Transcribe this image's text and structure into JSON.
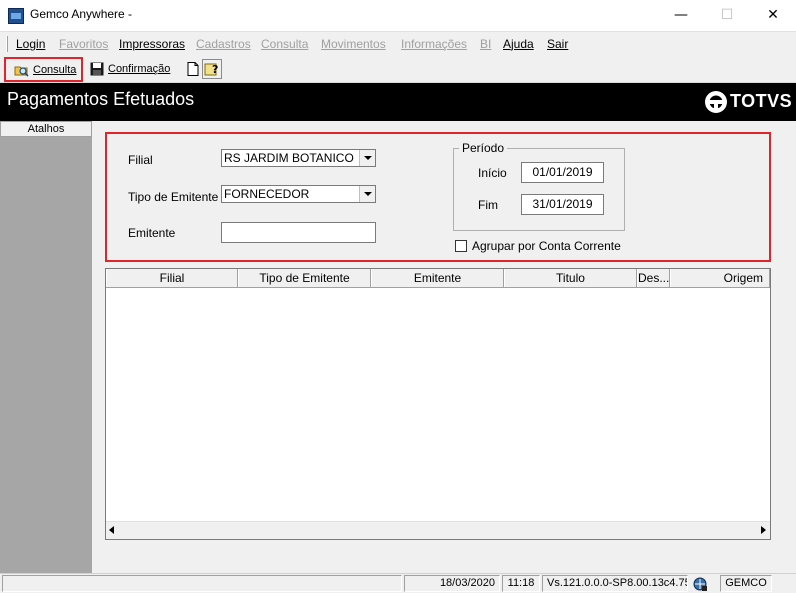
{
  "window": {
    "title": "Gemco Anywhere -",
    "minimize_glyph": "—",
    "maximize_glyph": "☐",
    "close_glyph": "✕"
  },
  "menu": {
    "items": [
      {
        "label": "Login",
        "enabled": true
      },
      {
        "label": "Favoritos",
        "enabled": false
      },
      {
        "label": "Impressoras",
        "enabled": true
      },
      {
        "label": "Cadastros",
        "enabled": false
      },
      {
        "label": "Consulta",
        "enabled": false
      },
      {
        "label": "Movimentos",
        "enabled": false
      },
      {
        "label": "Informações",
        "enabled": false
      },
      {
        "label": "BI",
        "enabled": false
      },
      {
        "label": "Ajuda",
        "enabled": true
      },
      {
        "label": "Sair",
        "enabled": true
      }
    ]
  },
  "toolbar": {
    "consulta_label": "Consulta",
    "confirmacao_label": "Confirmação"
  },
  "header": {
    "title": "Pagamentos Efetuados",
    "brand": "TOTVS"
  },
  "sidebar": {
    "atalhos_label": "Atalhos"
  },
  "filters": {
    "filial_label": "Filial",
    "filial_value": "RS JARDIM BOTANICO",
    "tipo_emitente_label": "Tipo de Emitente",
    "tipo_emitente_value": "FORNECEDOR",
    "emitente_label": "Emitente",
    "emitente_value": "",
    "periodo_label": "Período",
    "inicio_label": "Início",
    "inicio_value": "01/01/2019",
    "fim_label": "Fim",
    "fim_value": "31/01/2019",
    "agrupar_label": "Agrupar por Conta Corrente",
    "agrupar_checked": false
  },
  "grid": {
    "columns": [
      "Filial",
      "Tipo de Emitente",
      "Emitente",
      "Titulo",
      "Des...",
      "Origem"
    ],
    "rows": []
  },
  "status": {
    "date": "18/03/2020",
    "time": "11:18",
    "version": "Vs.121.0.0.0-SP8.00.13c4.75",
    "system": "GEMCO"
  },
  "colors": {
    "highlight": "#e0242b",
    "banner": "#000000",
    "sidebar": "#a6a6a6"
  }
}
